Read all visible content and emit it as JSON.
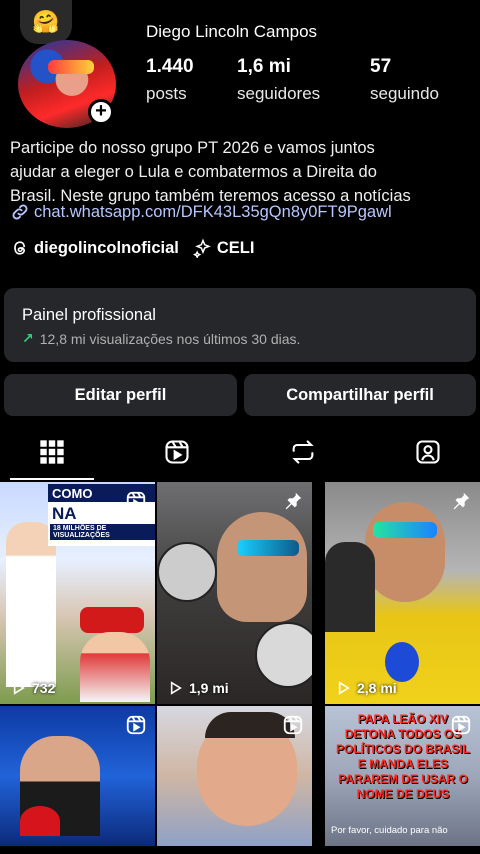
{
  "profile": {
    "emoji_note": "🤗",
    "display_name": "Diego Lincoln Campos",
    "stats": [
      {
        "value": "1.440",
        "label": "posts"
      },
      {
        "value": "1,6 mi",
        "label": "seguidores"
      },
      {
        "value": "57",
        "label": "seguindo"
      }
    ],
    "bio_lines": [
      "Participe do nosso grupo PT 2026 e vamos juntos",
      "ajudar a eleger o Lula e combatermos a Direita do",
      "Brasil. Neste grupo também teremos acesso a notícias"
    ],
    "link": "chat.whatsapp.com/DFK43L35gQn8y0FT9Pgawl",
    "threads_handle": "diegolincolnoficial",
    "category_tag": "CELI"
  },
  "panel": {
    "title": "Painel profissional",
    "subtitle": "12,8 mi visualizações nos últimos 30 dias."
  },
  "buttons": {
    "edit": "Editar perfil",
    "share": "Compartilhar perfil"
  },
  "tabs": [
    {
      "icon": "grid-icon",
      "active": true
    },
    {
      "icon": "reels-icon",
      "active": false
    },
    {
      "icon": "reposts-icon",
      "active": false
    },
    {
      "icon": "tagged-icon",
      "active": false
    }
  ],
  "posts": [
    {
      "title_line1": "COMO VIRALIZAR",
      "title_line2": "NA INTERNET",
      "caption": "18 MILHÕES DE VISUALIZAÇÕES",
      "views": "732",
      "corner_icon": "reels-icon"
    },
    {
      "views": "1,9 mi",
      "corner_icon": "pin-icon"
    },
    {
      "views": "2,8 mi",
      "corner_icon": "pin-icon"
    },
    {
      "corner_icon": "reels-icon"
    },
    {
      "corner_icon": "reels-icon"
    },
    {
      "text": "PAPA LEÃO XIV DETONA TODOS OS POLÍTICOS DO BRASIL E MANDA ELES PARAREM DE USAR O NOME DE DEUS",
      "footer": "Por favor, cuidado para não",
      "corner_icon": "reels-icon"
    }
  ],
  "colors": {
    "background": "#000000",
    "card": "#26272b",
    "link": "#b7c6ff",
    "growth": "#2fd07a"
  }
}
